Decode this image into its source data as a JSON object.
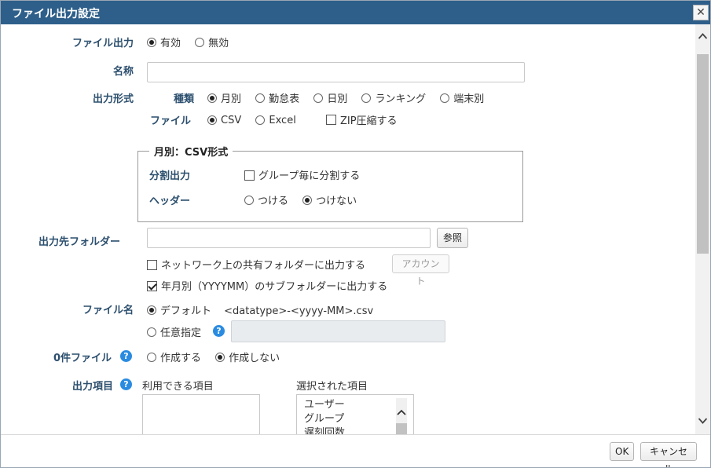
{
  "dialog": {
    "title": "ファイル出力設定",
    "close_symbol": "✕"
  },
  "file_output": {
    "label": "ファイル出力",
    "options": [
      "有効",
      "無効"
    ],
    "selected": "有効"
  },
  "name": {
    "label": "名称",
    "value": ""
  },
  "output_format": {
    "label": "出力形式",
    "kind": {
      "label": "種類",
      "options": [
        "月別",
        "勤怠表",
        "日別",
        "ランキング",
        "端末別"
      ],
      "selected": "月別"
    },
    "file": {
      "label": "ファイル",
      "options": [
        "CSV",
        "Excel"
      ],
      "selected": "CSV",
      "zip_label": "ZIP圧縮する",
      "zip_checked": false
    }
  },
  "group_box": {
    "legend": "月別：CSV形式",
    "split": {
      "label": "分割出力",
      "checkbox_label": "グループ毎に分割する",
      "checked": false
    },
    "header": {
      "label": "ヘッダー",
      "options": [
        "つける",
        "つけない"
      ],
      "selected": "つけない"
    }
  },
  "output_folder": {
    "label": "出力先フォルダー",
    "value": "",
    "browse_button": "参照",
    "network": {
      "label": "ネットワーク上の共有フォルダーに出力する",
      "checked": false,
      "account_button": "アカウント"
    },
    "subfolder": {
      "label": "年月別（YYYYMM）のサブフォルダーに出力する",
      "checked": true
    }
  },
  "file_name": {
    "label": "ファイル名",
    "default_label": "デフォルト",
    "default_pattern": "<datatype>-<yyyy-MM>.csv",
    "custom_label": "任意指定",
    "selected": "default",
    "help": "?"
  },
  "zero_file": {
    "label": "0件ファイル",
    "help": "?",
    "options": [
      "作成する",
      "作成しない"
    ],
    "selected": "作成しない"
  },
  "output_items": {
    "label": "出力項目",
    "help": "?",
    "available_label": "利用できる項目",
    "selected_label": "選択された項目",
    "available": [],
    "selected": [
      "ユーザー",
      "グループ",
      "遅刻回数"
    ]
  },
  "footer": {
    "ok": "OK",
    "cancel": "キャンセル"
  }
}
